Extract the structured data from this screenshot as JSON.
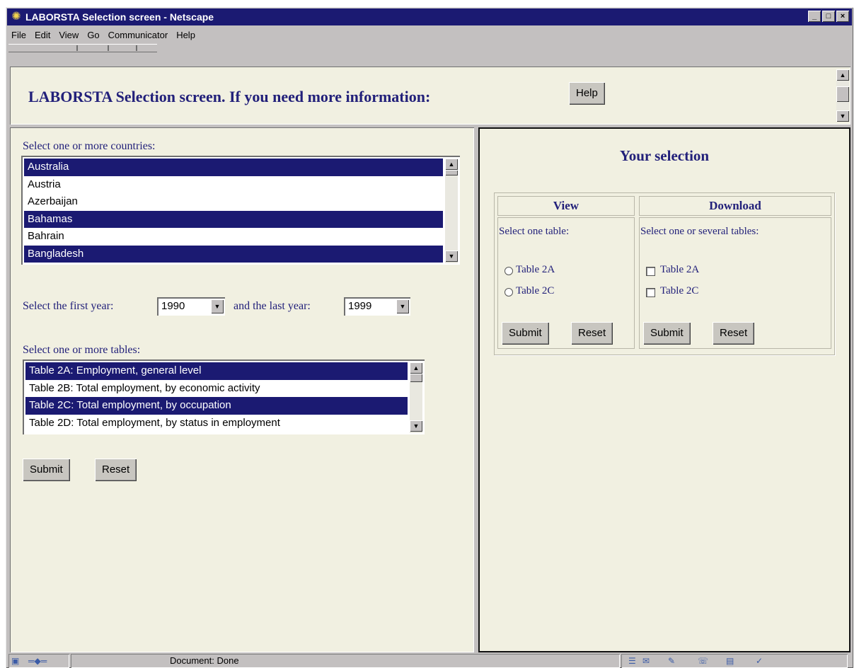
{
  "window": {
    "title": "LABORSTA Selection screen - Netscape",
    "menu": [
      "File",
      "Edit",
      "View",
      "Go",
      "Communicator",
      "Help"
    ]
  },
  "top_frame": {
    "heading": "LABORSTA Selection screen.   If you need more information:",
    "help_button": "Help"
  },
  "left_frame": {
    "countries_label": "Select one or more countries:",
    "countries": [
      {
        "label": "Australia",
        "selected": true
      },
      {
        "label": "Austria",
        "selected": false
      },
      {
        "label": "Azerbaijan",
        "selected": false
      },
      {
        "label": "Bahamas",
        "selected": true
      },
      {
        "label": "Bahrain",
        "selected": false
      },
      {
        "label": "Bangladesh",
        "selected": true
      }
    ],
    "first_year_label": "Select the first year:",
    "first_year": "1990",
    "last_year_label": "and the last year:",
    "last_year": "1999",
    "tables_label": "Select one or more tables:",
    "tables": [
      {
        "label": "Table 2A: Employment, general level",
        "selected": true
      },
      {
        "label": "Table 2B: Total employment, by economic activity",
        "selected": false
      },
      {
        "label": "Table 2C: Total employment, by occupation",
        "selected": true
      },
      {
        "label": "Table 2D: Total employment, by status in employment",
        "selected": false
      }
    ],
    "submit_label": "Submit",
    "reset_label": "Reset"
  },
  "right_frame": {
    "heading": "Your selection",
    "view": {
      "header": "View",
      "instruction": "Select one table:",
      "options": [
        "Table 2A",
        "Table 2C"
      ],
      "submit_label": "Submit",
      "reset_label": "Reset"
    },
    "download": {
      "header": "Download",
      "instruction": "Select one or several tables:",
      "options": [
        "Table 2A",
        "Table 2C"
      ],
      "submit_label": "Submit",
      "reset_label": "Reset"
    }
  },
  "status_bar": {
    "text": "Document: Done"
  },
  "colors": {
    "title_bar": "#1b1a72",
    "selection": "#1b1a72",
    "frame_bg": "#f1f0e1",
    "heading_text": "#22207a"
  }
}
